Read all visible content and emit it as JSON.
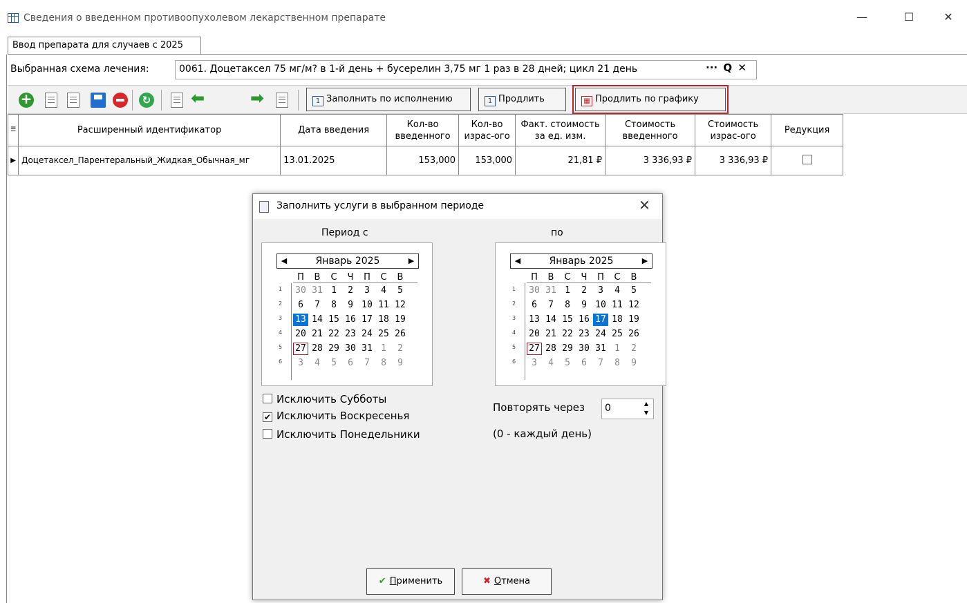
{
  "window": {
    "title": "Сведения о введенном противоопухолевом лекарственном препарате",
    "minimize": "—",
    "maximize": "☐",
    "close": "✕"
  },
  "tabs": [
    {
      "label": "Ввод препарата для случаев с 2025"
    }
  ],
  "schema": {
    "label": "Выбранная схема лечения:",
    "value": "0061. Доцетаксел 75 мг/м? в 1-й день + бусерелин 3,75 мг 1 раз в 28 дней; цикл 21 день",
    "more": "···",
    "search": "Q",
    "clear": "✕"
  },
  "toolbar": {
    "fill_by_execution": "Заполнить по исполнению",
    "prolong": "Продлить",
    "prolong_by_schedule": "Продлить по графику",
    "calendar_glyph": "1",
    "highlight_color": "#c0222a"
  },
  "grid": {
    "headers": [
      "Расширенный идентификатор",
      "Дата введения",
      "Кол-во введенного",
      "Кол-во израс-ого",
      "Факт. стоимость за ед. изм.",
      "Стоимость введенного",
      "Стоимость израс-ого",
      "Редукция"
    ],
    "rows": [
      {
        "id": "Доцетаксел_Парентеральный_Жидкая_Обычная_мг",
        "date": "13.01.2025",
        "qty_in": "153,000",
        "qty_used": "153,000",
        "unit_cost": "21,81 ₽",
        "cost_in": "3 336,93 ₽",
        "cost_used": "3 336,93 ₽",
        "reduction": false
      }
    ]
  },
  "dialog": {
    "title": "Заполнить услуги в выбранном периоде",
    "close": "✕",
    "from_label": "Период с",
    "to_label": "по",
    "calendar_from": {
      "month": "Январь 2025",
      "selected": 13,
      "today": 27
    },
    "calendar_to": {
      "month": "Январь 2025",
      "selected": 17,
      "today": 27
    },
    "weekday_headers": [
      "П",
      "В",
      "С",
      "Ч",
      "П",
      "С",
      "В"
    ],
    "week_numbers": [
      "1",
      "2",
      "3",
      "4",
      "5",
      "6"
    ],
    "options": [
      {
        "label": "Исключить Субботы",
        "checked": false
      },
      {
        "label": "Исключить Воскресенья",
        "checked": true
      },
      {
        "label": "Исключить Понедельники",
        "checked": false
      }
    ],
    "repeat_label": "Повторять через",
    "repeat_value": "0",
    "repeat_hint": "(0 - каждый день)",
    "apply_prefix": "П",
    "apply_rest": "рименить",
    "cancel_prefix": "О",
    "cancel_rest": "тмена",
    "selected_color": "#0a74d4"
  }
}
